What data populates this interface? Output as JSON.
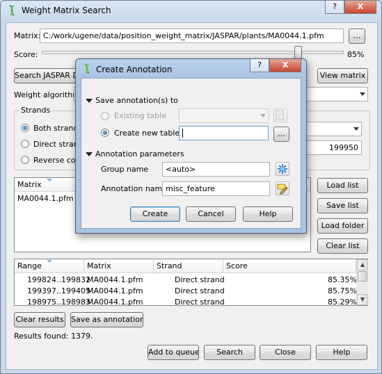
{
  "main_window": {
    "title": "Weight Matrix Search",
    "help_button": "?",
    "close_button": "X",
    "matrix_label": "Matrix:",
    "matrix_path": "C:/work/ugene/data/position_weight_matrix/JASPAR/plants/MA0044.1.pfm",
    "browse_button": "...",
    "score_label": "Score:",
    "score_value": "85%",
    "score_level": 0.85,
    "search_jaspar_button": "Search JASPAR Da",
    "view_matrix_button": "View matrix",
    "weight_algorithm_label": "Weight algorithm",
    "strands_label": "Strands",
    "strand_options": [
      "Both strands",
      "Direct strand",
      "Reverse comp"
    ],
    "range_value": "199950",
    "matrix_list": {
      "header": "Matrix",
      "items": [
        "MA0044.1.pfm"
      ]
    },
    "list_buttons": [
      "Load list",
      "Save list",
      "Load folder",
      "Clear list"
    ],
    "results": {
      "columns": [
        "Range",
        "Matrix",
        "Strand",
        "Score"
      ],
      "rows": [
        {
          "range": "199824..199832",
          "matrix": "MA0044.1.pfm",
          "strand": "Direct strand",
          "score": "85.35%"
        },
        {
          "range": "199397..199405",
          "matrix": "MA0044.1.pfm",
          "strand": "Direct strand",
          "score": "85.75%"
        },
        {
          "range": "198975..198983",
          "matrix": "MA0044.1.pfm",
          "strand": "Direct strand",
          "score": "85.29%"
        }
      ]
    },
    "clear_results_button": "Clear results",
    "save_annotations_button": "Save as annotations",
    "results_found": "Results found: 1379.",
    "bottom_buttons": {
      "add_to_queue": "Add to queue",
      "search": "Search",
      "close": "Close",
      "help": "Help"
    }
  },
  "dialog": {
    "title": "Create Annotation",
    "help_button": "?",
    "close_button": "X",
    "save_section": "Save annotation(s) to",
    "existing_table_label": "Existing table",
    "create_new_table_label": "Create new table",
    "new_table_value": "",
    "browse_button": "...",
    "params_section": "Annotation parameters",
    "group_name_label": "Group name",
    "group_name_value": "<auto>",
    "annotation_name_label": "Annotation name",
    "annotation_name_value": "misc_feature",
    "create_button": "Create",
    "cancel_button": "Cancel",
    "help_text_button": "Help"
  }
}
